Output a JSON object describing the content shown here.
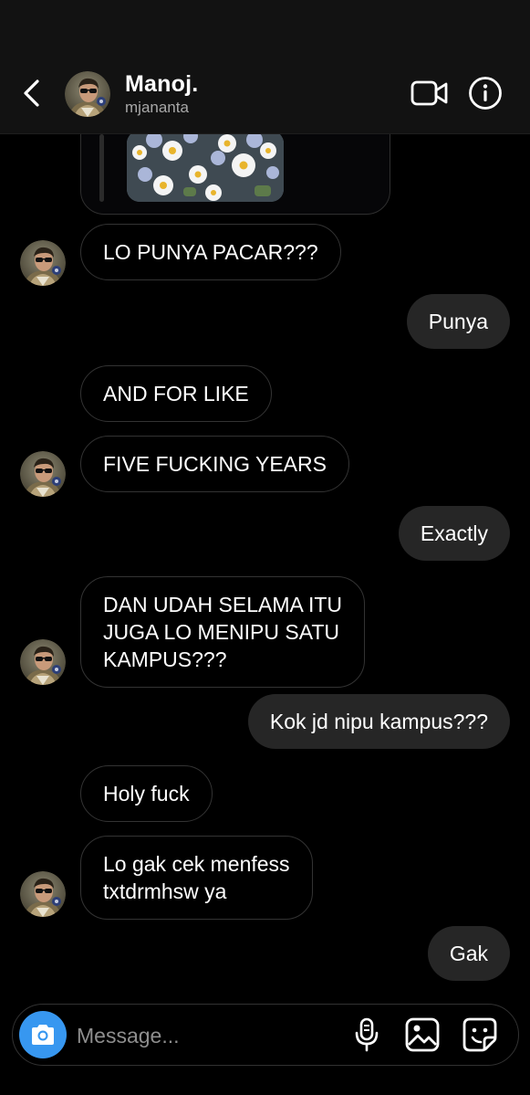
{
  "header": {
    "name": "Manoj.",
    "username": "mjananta",
    "icons": {
      "back": "chevron-left-icon",
      "video": "video-camera-icon",
      "info": "info-icon"
    }
  },
  "messages": [
    {
      "direction": "in",
      "text": "LO PUNYA PACAR???"
    },
    {
      "direction": "out",
      "text": "Punya"
    },
    {
      "direction": "in",
      "text": "AND FOR LIKE"
    },
    {
      "direction": "in",
      "text": "FIVE FUCKING YEARS"
    },
    {
      "direction": "out",
      "text": "Exactly"
    },
    {
      "direction": "in",
      "text": "DAN UDAH SELAMA ITU\nJUGA LO MENIPU SATU\nKAMPUS???"
    },
    {
      "direction": "out",
      "text": "Kok jd nipu kampus???"
    },
    {
      "direction": "in",
      "text": "Holy fuck"
    },
    {
      "direction": "in",
      "text": "Lo gak cek menfess\ntxtdrmhsw ya"
    },
    {
      "direction": "out",
      "text": "Gak"
    }
  ],
  "composer": {
    "placeholder": "Message...",
    "icons": {
      "camera": "camera-icon",
      "mic": "microphone-icon",
      "gallery": "gallery-icon",
      "sticker": "sticker-icon"
    }
  },
  "colors": {
    "background": "#000000",
    "header": "#121212",
    "outgoing_bubble": "#262626",
    "incoming_border": "#333333",
    "camera_button": "#3797f0",
    "secondary_text": "#a8a8a8"
  }
}
